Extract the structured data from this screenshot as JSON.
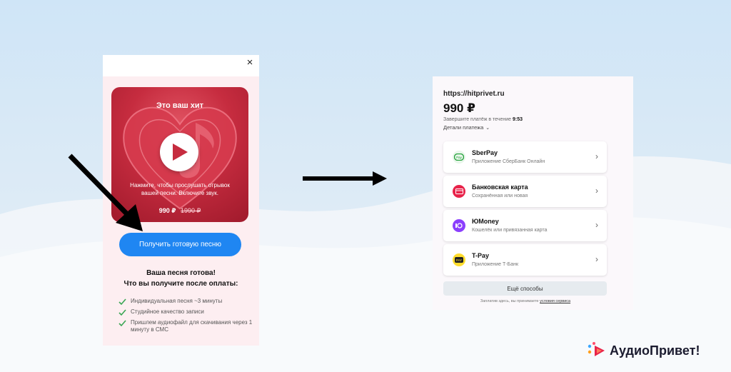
{
  "colors": {
    "accent_blue": "#1f86f2",
    "card_red": "#c62c3f",
    "check_green": "#3aa655",
    "sberpay": "#21a038",
    "bank_card": "#e8234a",
    "yumoney": "#8b3ffd",
    "tpay": "#ffdd2d"
  },
  "modal": {
    "close_icon": "×",
    "card": {
      "title": "Это ваш хит",
      "hint": "Нажмите, чтобы прослушать отрывок вашей песни. Включите звук.",
      "price": "990 ₽",
      "old_price": "1990 ₽"
    },
    "get_button": "Получить готовую песню",
    "ready_line1": "Ваша песня готова!",
    "ready_line2": "Что вы получите после оплаты:",
    "benefits": [
      "Индивидуальная песня ~3 минуты",
      "Студийное качество записи",
      "Пришлем аудиофайл для скачивания через 1 минуту в СМС"
    ]
  },
  "payment": {
    "url": "https://hitprivet.ru",
    "amount": "990 ₽",
    "timer_text": "Завершите платёж в течение ",
    "timer_value": "9:53",
    "details": "Детали платежа",
    "methods": [
      {
        "name": "SberPay",
        "sub": "Приложение СберБанк Онлайн",
        "icon": "sberpay-icon"
      },
      {
        "name": "Банковская карта",
        "sub": "Сохранённая или новая",
        "icon": "bank-card-icon"
      },
      {
        "name": "ЮMoney",
        "sub": "Кошелёк или привязанная карта",
        "icon": "yumoney-icon"
      },
      {
        "name": "T-Pay",
        "sub": "Приложение Т-Банк",
        "icon": "tpay-icon"
      }
    ],
    "more_button": "Ещё способы",
    "terms_text": "Заплатив здесь, вы принимаете ",
    "terms_link": "условия сервиса"
  },
  "brand": {
    "name": "АудиоПривет!"
  }
}
